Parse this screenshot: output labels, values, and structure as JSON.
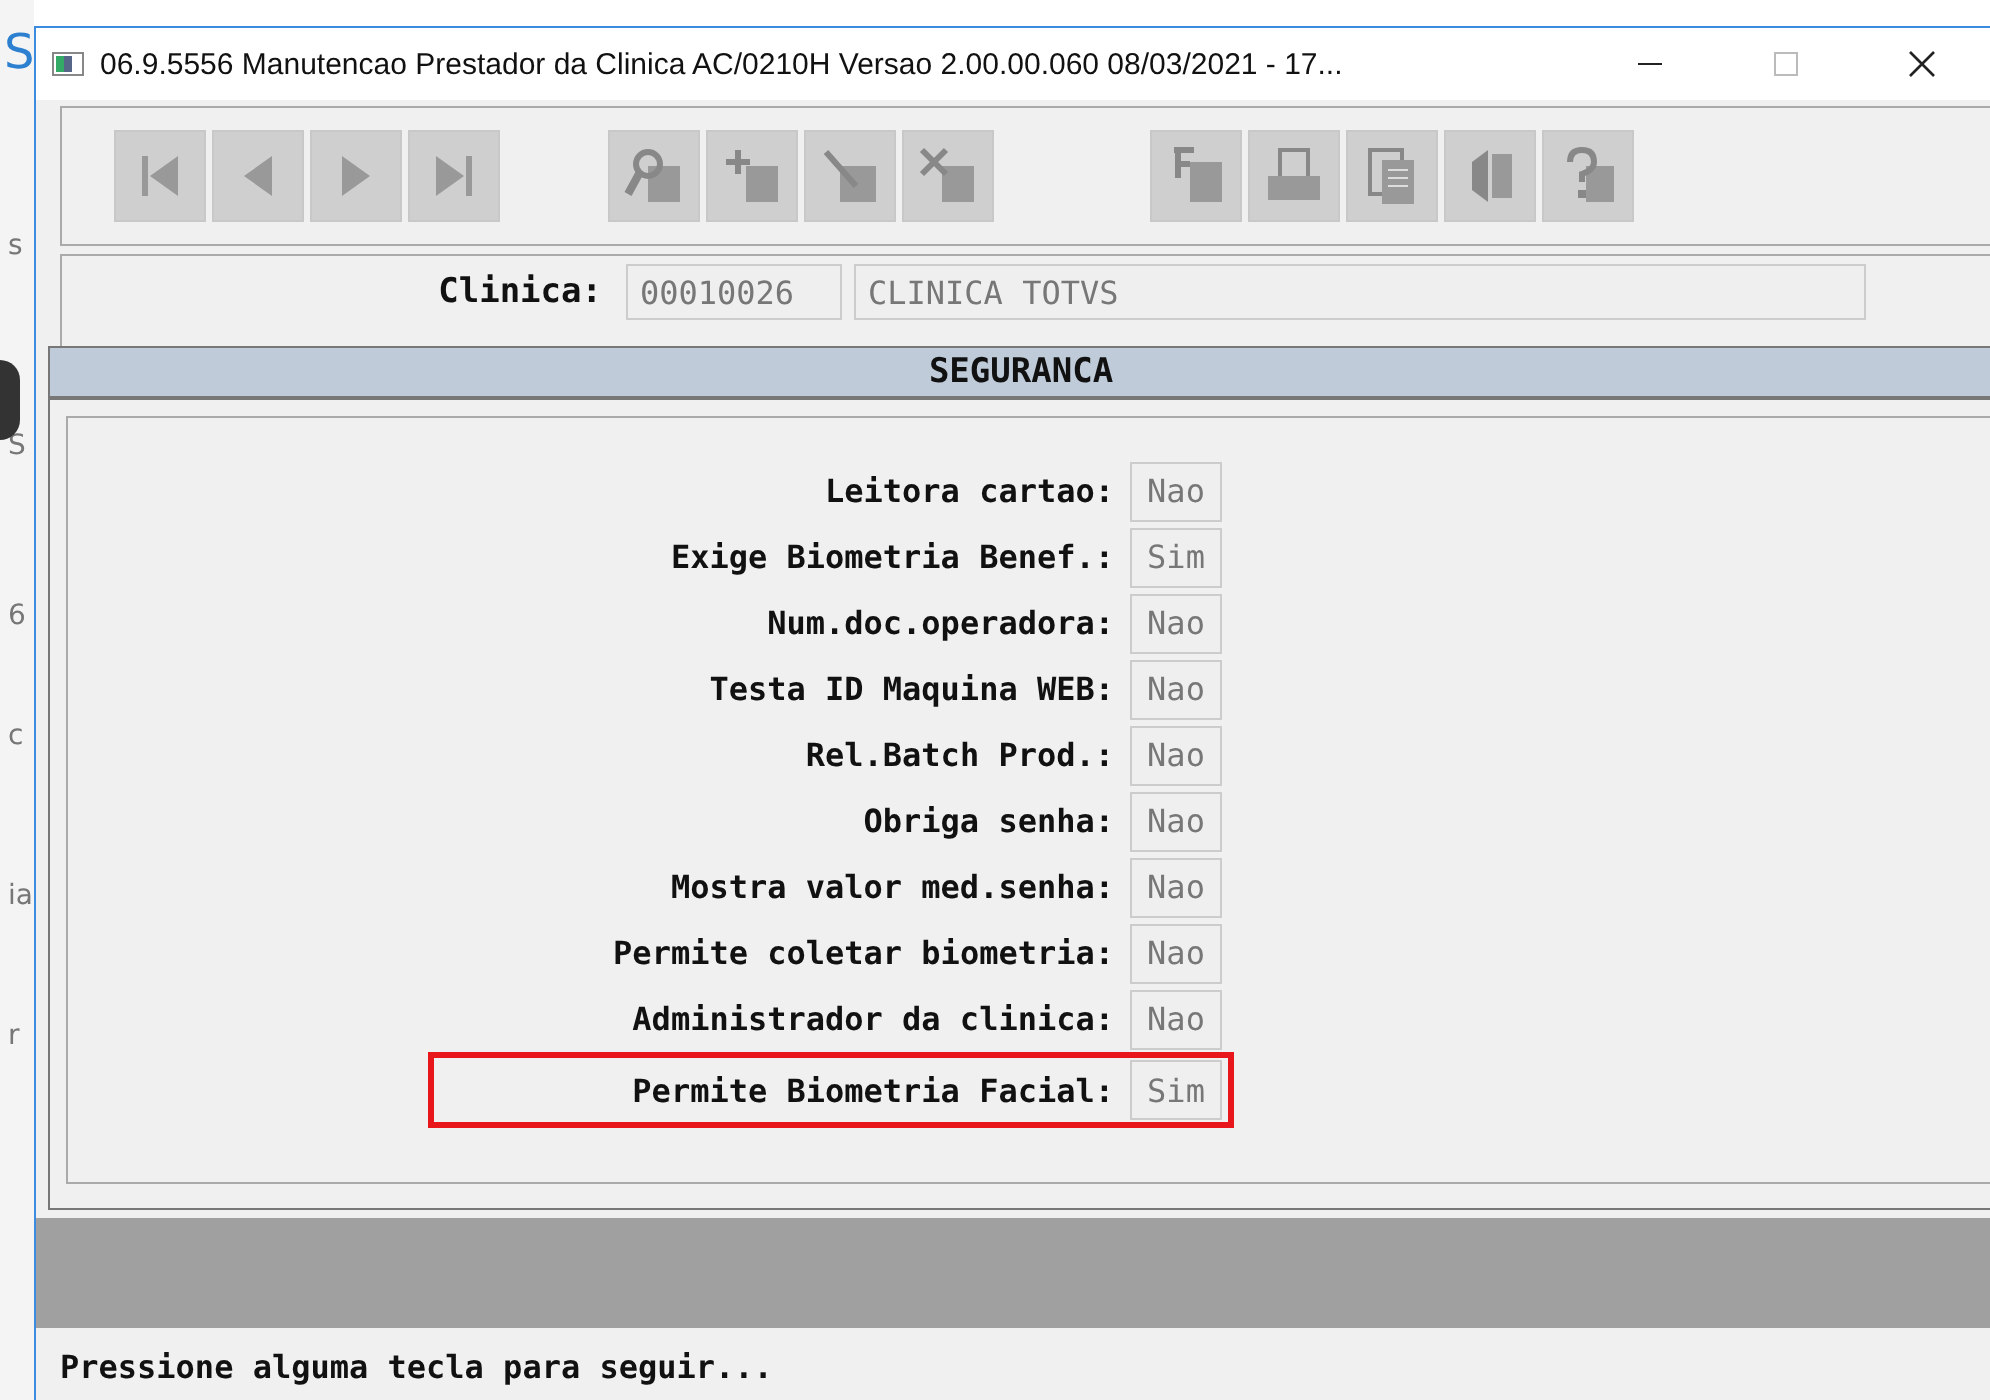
{
  "background_window": {
    "fragments": [
      "S",
      "s",
      "S",
      "6",
      "c",
      "ia",
      "r"
    ]
  },
  "window": {
    "title": "06.9.5556 Manutencao  Prestador da Clinica AC/0210H Versao 2.00.00.060 08/03/2021 - 17..."
  },
  "toolbar": {
    "groups": [
      {
        "buttons": [
          {
            "kind": "first",
            "disabled": true
          },
          {
            "kind": "prev",
            "disabled": true
          },
          {
            "kind": "next",
            "disabled": true
          },
          {
            "kind": "last",
            "disabled": true
          }
        ]
      },
      {
        "buttons": [
          {
            "kind": "search",
            "disabled": true
          },
          {
            "kind": "add",
            "disabled": true
          },
          {
            "kind": "edit",
            "disabled": true
          },
          {
            "kind": "delete",
            "disabled": true
          }
        ]
      },
      {
        "buttons": [
          {
            "kind": "filter",
            "disabled": true
          },
          {
            "kind": "print",
            "disabled": true
          },
          {
            "kind": "copy",
            "disabled": true
          },
          {
            "kind": "exit",
            "disabled": true
          },
          {
            "kind": "help",
            "disabled": true
          }
        ]
      }
    ]
  },
  "form": {
    "clinica": {
      "label": "Clinica:",
      "code": "00010026",
      "name": "CLINICA TOTVS"
    }
  },
  "dialog": {
    "title": "SEGURANCA",
    "fields": [
      {
        "label": "Leitora cartao:",
        "value": "Nao",
        "highlighted": false
      },
      {
        "label": "Exige Biometria Benef.:",
        "value": "Sim",
        "highlighted": false
      },
      {
        "label": "Num.doc.operadora:",
        "value": "Nao",
        "highlighted": false
      },
      {
        "label": "Testa ID Maquina WEB:",
        "value": "Nao",
        "highlighted": false
      },
      {
        "label": "Rel.Batch Prod.:",
        "value": "Nao",
        "highlighted": false
      },
      {
        "label": "Obriga senha:",
        "value": "Nao",
        "highlighted": false
      },
      {
        "label": "Mostra valor med.senha:",
        "value": "Nao",
        "highlighted": false
      },
      {
        "label": "Permite coletar biometria:",
        "value": "Nao",
        "highlighted": false
      },
      {
        "label": "Administrador da clinica:",
        "value": "Nao",
        "highlighted": false
      },
      {
        "label": "Permite Biometria Facial:",
        "value": "Sim",
        "highlighted": true
      }
    ]
  },
  "status_bar": {
    "message": "Pressione alguma tecla para seguir..."
  }
}
